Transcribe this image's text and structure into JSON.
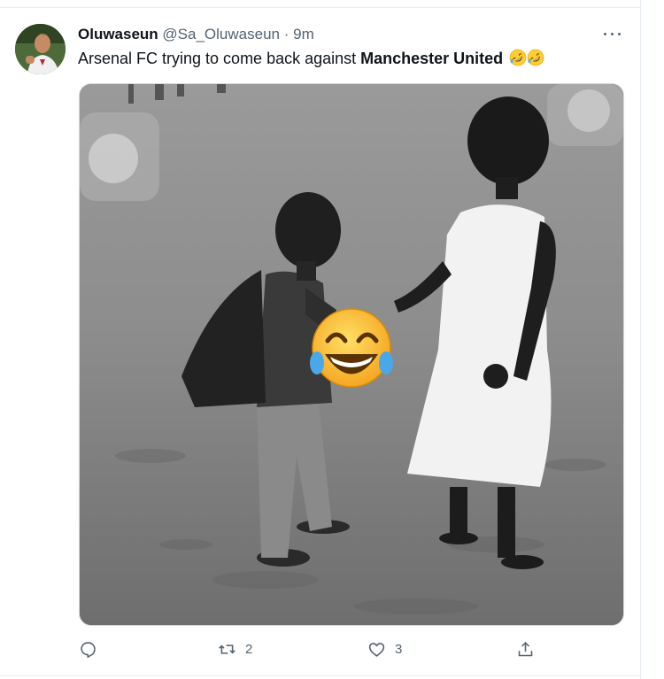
{
  "tweet": {
    "author_name": "Oluwaseun",
    "author_handle": "@Sa_Oluwaseun",
    "separator": "·",
    "time": "9m",
    "text_prefix": "Arsenal FC trying to come back against ",
    "text_bold": "Manchester United",
    "text_emojis": [
      "rolling-on-floor-laughing-emoji",
      "rolling-on-floor-laughing-emoji"
    ],
    "media": {
      "overlay_emoji": "face-with-tears-of-joy-emoji",
      "style": "black-and-white"
    }
  },
  "actions": {
    "reply": {
      "icon": "reply-icon",
      "count": ""
    },
    "retweet": {
      "icon": "retweet-icon",
      "count": "2"
    },
    "like": {
      "icon": "heart-icon",
      "count": "3"
    },
    "share": {
      "icon": "share-icon",
      "count": ""
    }
  },
  "colors": {
    "text": "#0f1419",
    "secondary": "#536471",
    "border": "#cfd9de",
    "emoji_yellow": "#ffcc33"
  }
}
